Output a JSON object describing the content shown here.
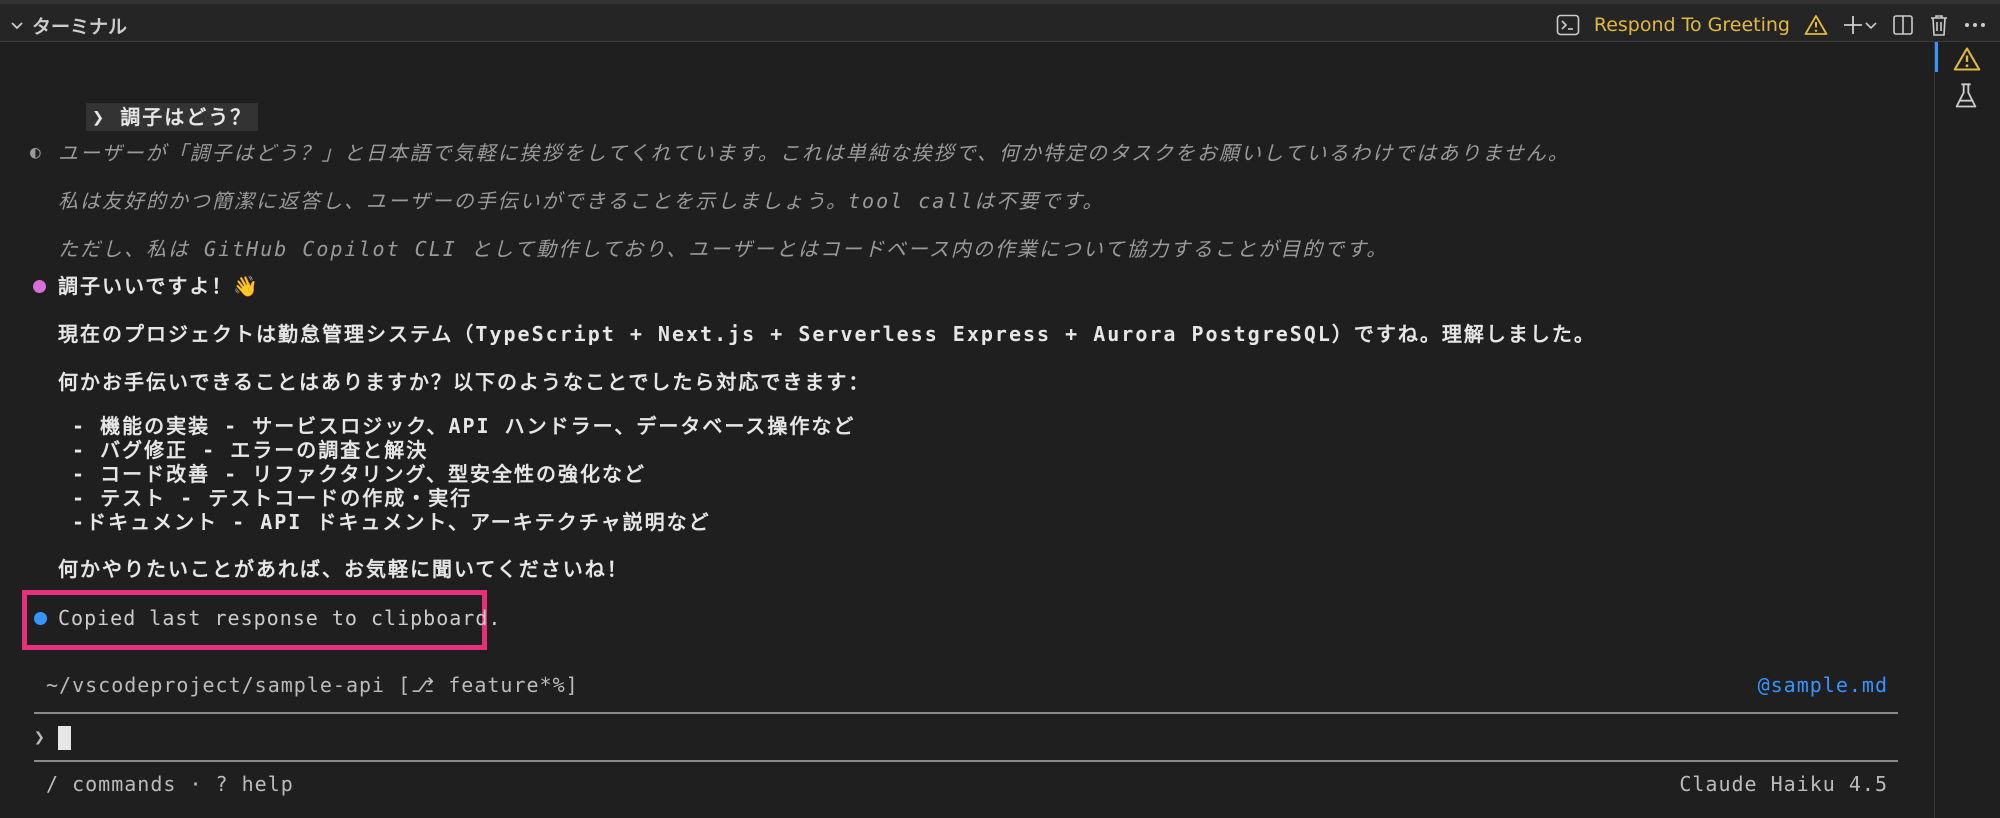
{
  "panel": {
    "title": "ターミナル",
    "task_label": "Respond To Greeting",
    "colors": {
      "accent": "#e2b93d",
      "highlight_box": "#e6317a",
      "link": "#3794ff"
    }
  },
  "conversation": {
    "user_prompt": "❯ 調子はどう？",
    "thinking": [
      "ユーザーが「調子はどう？」と日本語で気軽に挨拶をしてくれています。これは単純な挨拶で、何か特定のタスクをお願いしているわけではありません。",
      "私は友好的かつ簡潔に返答し、ユーザーの手伝いができることを示しましょう。tool callは不要です。",
      "ただし、私は GitHub Copilot CLI として動作しており、ユーザーとはコードベース内の作業について協力することが目的です。"
    ],
    "response_heading": "調子いいですよ！👋",
    "response_intro": "現在のプロジェクトは勤怠管理システム（TypeScript + Next.js + Serverless Express + Aurora PostgreSQL）ですね。理解しました。",
    "response_question": "何かお手伝いできることはありますか？以下のようなことでしたら対応できます：",
    "response_items": [
      " - 機能の実装 - サービスロジック、API ハンドラー、データベース操作など",
      " - バグ修正 - エラーの調査と解決",
      " - コード改善 - リファクタリング、型安全性の強化など",
      " - テスト - テストコードの作成・実行",
      " -ドキュメント - API ドキュメント、アーキテクチャ説明など"
    ],
    "response_closing": "何かやりたいことがあれば、お気軽に聞いてくださいね！",
    "copied_message": "Copied last response to clipboard."
  },
  "status": {
    "cwd": "~/vscodeproject/sample-api [⎇ feature*%]",
    "mention": "@sample.md",
    "input_prompt": "❯",
    "hints": "/ commands · ? help",
    "model": "Claude Haiku 4.5"
  }
}
